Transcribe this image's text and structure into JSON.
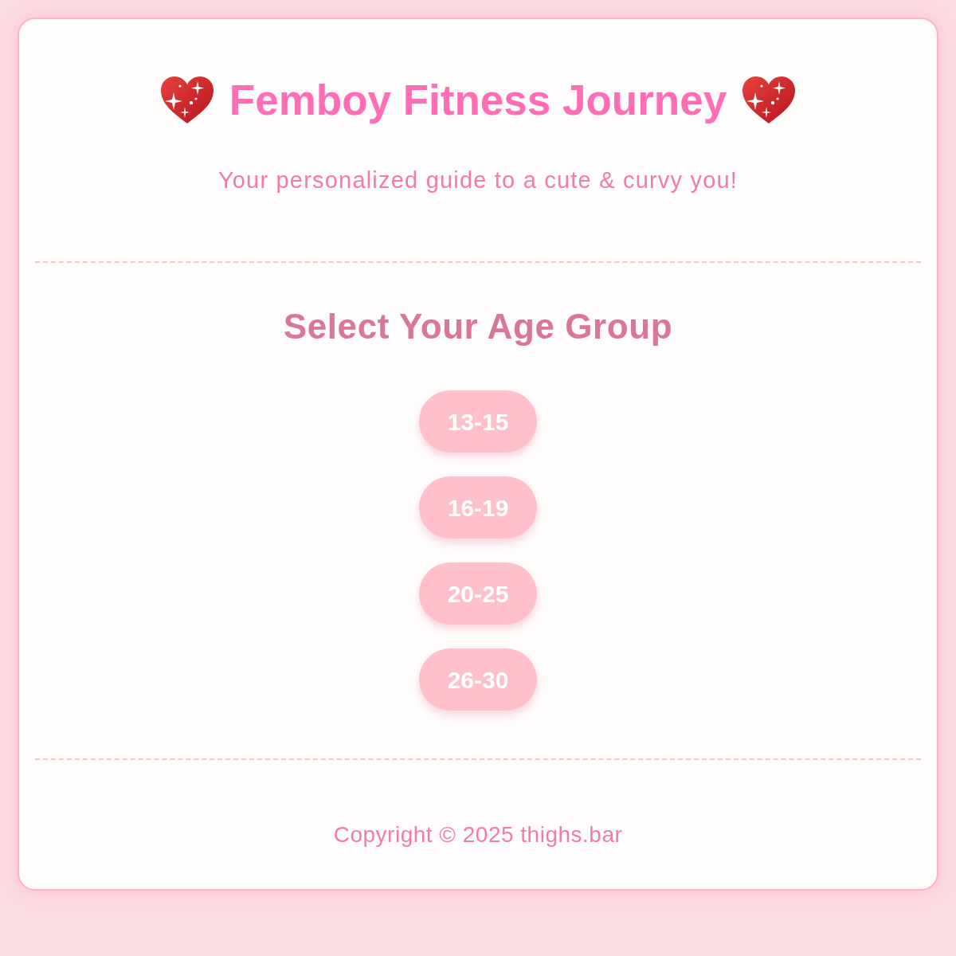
{
  "header": {
    "title": "Femboy Fitness Journey",
    "subtitle": "Your personalized guide to a cute & curvy you!"
  },
  "age_section": {
    "heading": "Select Your Age Group",
    "age_groups": [
      {
        "label": "13-15"
      },
      {
        "label": "16-19"
      },
      {
        "label": "20-25"
      },
      {
        "label": "26-30"
      }
    ]
  },
  "footer": {
    "copyright": "Copyright © 2025 thighs.bar"
  }
}
